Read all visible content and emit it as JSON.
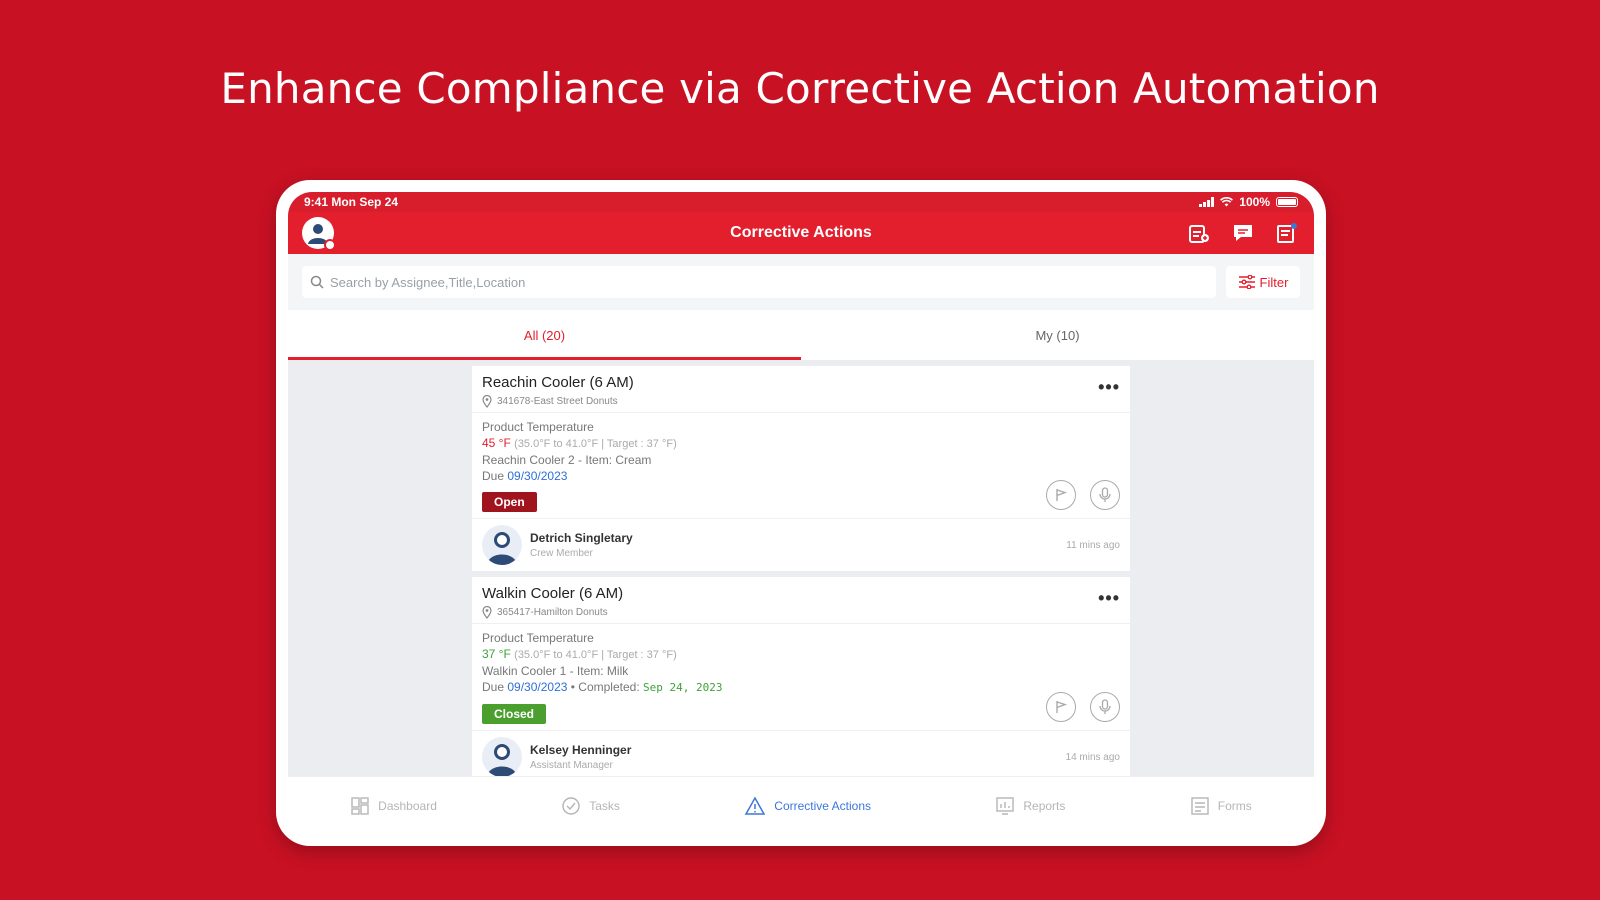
{
  "headline": "Enhance Compliance via Corrective Action Automation",
  "status_bar": {
    "time": "9:41 Mon Sep 24",
    "battery": "100%"
  },
  "header": {
    "title": "Corrective Actions",
    "icons": [
      "profile-avatar-icon",
      "add-task-icon",
      "chat-icon",
      "notes-icon"
    ]
  },
  "search": {
    "placeholder": "Search by Assignee,Title,Location",
    "value": ""
  },
  "filter": {
    "label": "Filter"
  },
  "tabs": [
    {
      "label": "All (20)",
      "active": true
    },
    {
      "label": "My (10)",
      "active": false
    }
  ],
  "cards": [
    {
      "title": "Reachin Cooler (6 AM)",
      "location": "341678-East Street Donuts",
      "metric_label": "Product Temperature",
      "temp": "45 °F",
      "range": "(35.0°F to 41.0°F | Target : 37 °F)",
      "item": "Reachin Cooler 2 - Item: Cream",
      "due_label": "Due",
      "due": "09/30/2023",
      "completed_label": "",
      "completed": "",
      "status": "Open",
      "person_name": "Detrich Singletary",
      "person_role": "Crew Member",
      "time_ago": "11 mins ago"
    },
    {
      "title": "Walkin Cooler (6 AM)",
      "location": "365417-Hamilton Donuts",
      "metric_label": "Product Temperature",
      "temp": "37 °F",
      "range": "(35.0°F to 41.0°F | Target : 37 °F)",
      "item": "Walkin Cooler 1 - Item: Milk",
      "due_label": "Due",
      "due": "09/30/2023",
      "completed_label": "• Completed:",
      "completed": "Sep 24, 2023",
      "status": "Closed",
      "person_name": "Kelsey Henninger",
      "person_role": "Assistant Manager",
      "time_ago": "14 mins ago"
    }
  ],
  "bottom_nav": [
    {
      "label": "Dashboard",
      "icon": "dashboard-icon",
      "active": false
    },
    {
      "label": "Tasks",
      "icon": "tasks-icon",
      "active": false
    },
    {
      "label": "Corrective Actions",
      "icon": "warning-triangle-icon",
      "active": true
    },
    {
      "label": "Reports",
      "icon": "reports-icon",
      "active": false
    },
    {
      "label": "Forms",
      "icon": "forms-icon",
      "active": false
    }
  ],
  "colors": {
    "brand_red": "#e31e2d",
    "background_red": "#c81123",
    "open": "#a0141e",
    "closed": "#4a9f2f",
    "link_blue": "#2f6fd6"
  }
}
